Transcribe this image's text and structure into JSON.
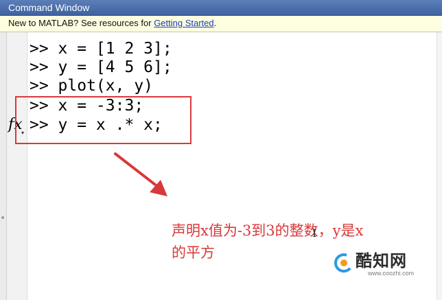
{
  "window": {
    "title": "Command Window"
  },
  "infobar": {
    "prefix": "New to MATLAB? See resources for ",
    "link": "Getting Started",
    "suffix": "."
  },
  "command_lines": [
    ">> x = [1 2 3];",
    ">> y = [4 5 6];",
    ">> plot(x, y)",
    ">> x = -3:3;",
    ">> y = x .* x;"
  ],
  "prompt_glyph": "fx",
  "annotation": {
    "line1": "声明x值为-3到3的整数，y是x",
    "line2": "的平方",
    "color": "#d9383a"
  },
  "watermark": {
    "name": "酷知网",
    "url": "www.coozhi.com"
  },
  "colors": {
    "titlebar": "#4a6eaa",
    "infobar_bg": "#fdfde0",
    "link": "#1c3fb5",
    "highlight": "#d9383a"
  },
  "icons": {
    "fx": "function-prompt-icon",
    "arrow": "annotation-arrow",
    "logo": "coozhi-logo"
  }
}
